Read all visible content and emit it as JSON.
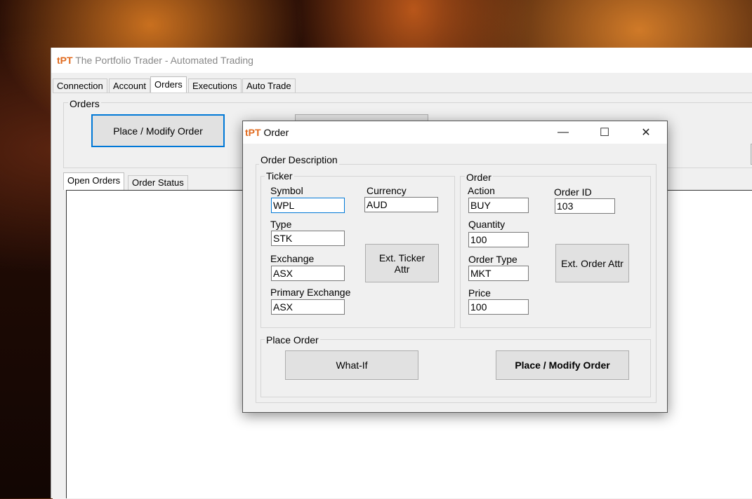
{
  "app": {
    "logo_t": "t",
    "logo_pt": "PT",
    "title": "The Portfolio Trader - Automated Trading",
    "tabs": [
      "Connection",
      "Account",
      "Orders",
      "Executions",
      "Auto Trade"
    ],
    "active_tab": "Orders"
  },
  "orders_panel": {
    "group_label": "Orders",
    "place_modify_label": "Place / Modify Order",
    "subtabs": [
      "Open Orders",
      "Order Status"
    ]
  },
  "dialog": {
    "logo_t": "t",
    "logo_pt": "PT",
    "title": "Order",
    "controls": {
      "minimize": "—",
      "maximize": "☐",
      "close": "✕"
    },
    "order_description_label": "Order Description",
    "ticker": {
      "group_label": "Ticker",
      "symbol_label": "Symbol",
      "symbol_value": "WPL",
      "currency_label": "Currency",
      "currency_value": "AUD",
      "type_label": "Type",
      "type_value": "STK",
      "exchange_label": "Exchange",
      "exchange_value": "ASX",
      "primary_exchange_label": "Primary Exchange",
      "primary_exchange_value": "ASX",
      "ext_ticker_attr_label": "Ext. Ticker Attr"
    },
    "order": {
      "group_label": "Order",
      "action_label": "Action",
      "action_value": "BUY",
      "order_id_label": "Order ID",
      "order_id_value": "103",
      "quantity_label": "Quantity",
      "quantity_value": "100",
      "order_type_label": "Order Type",
      "order_type_value": "MKT",
      "price_label": "Price",
      "price_value": "100",
      "ext_order_attr_label": "Ext. Order Attr"
    },
    "place_order": {
      "group_label": "Place Order",
      "what_if_label": "What-If",
      "place_modify_label": "Place / Modify Order"
    }
  },
  "colors": {
    "accent": "#0078d7",
    "logo": "#e06a1e",
    "window_bg": "#f0f0f0"
  }
}
